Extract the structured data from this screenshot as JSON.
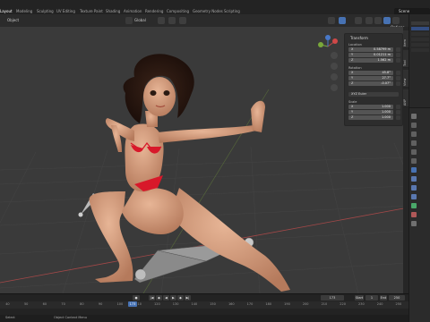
{
  "workspace_tabs": [
    {
      "label": "Layout",
      "active": true
    },
    {
      "label": "Modeling",
      "active": false
    },
    {
      "label": "Sculpting",
      "active": false
    },
    {
      "label": "UV Editing",
      "active": false
    },
    {
      "label": "Texture Paint",
      "active": false
    },
    {
      "label": "Shading",
      "active": false
    },
    {
      "label": "Animation",
      "active": false
    },
    {
      "label": "Rendering",
      "active": false
    },
    {
      "label": "Compositing",
      "active": false
    },
    {
      "label": "Geometry Nodes",
      "active": false
    },
    {
      "label": "Scripting",
      "active": false
    }
  ],
  "scene_name": "Scene",
  "viewport_header": {
    "object_menu": "Object",
    "transform_orientation": "Global",
    "options": "Options"
  },
  "npanel": {
    "title": "Transform",
    "location_label": "Location",
    "location": [
      {
        "axis": "X",
        "value": "0.58799 m"
      },
      {
        "axis": "Y",
        "value": "0.01211 m"
      },
      {
        "axis": "Z",
        "value": "1.562 m"
      }
    ],
    "rotation_label": "Rotation",
    "rotation": [
      {
        "axis": "X",
        "value": "45.8°"
      },
      {
        "axis": "Y",
        "value": "27.7°"
      },
      {
        "axis": "Z",
        "value": "-0.07°"
      }
    ],
    "rotation_mode": "XYZ Euler",
    "scale_label": "Scale",
    "scale": [
      {
        "axis": "X",
        "value": "1.000"
      },
      {
        "axis": "Y",
        "value": "1.000"
      },
      {
        "axis": "Z",
        "value": "1.000"
      }
    ],
    "tabs": [
      "Item",
      "Tool",
      "View",
      "ANP"
    ]
  },
  "timeline": {
    "current_frame": "173",
    "start_label": "Start",
    "start_value": "1",
    "end_label": "End",
    "end_value": "250",
    "ruler": [
      "40",
      "50",
      "60",
      "70",
      "80",
      "90",
      "100",
      "110",
      "120",
      "130",
      "140",
      "150",
      "160",
      "170",
      "180",
      "190",
      "200",
      "210",
      "220",
      "230",
      "240",
      "250"
    ]
  },
  "statusbar": {
    "select": "Select",
    "context_menu": "Object Context Menu"
  },
  "colors": {
    "accent": "#4772b3",
    "viewport_bg": "#3a3a3a",
    "skin": "#d39a78",
    "bikini": "#d8182a",
    "hair": "#2a1712"
  }
}
